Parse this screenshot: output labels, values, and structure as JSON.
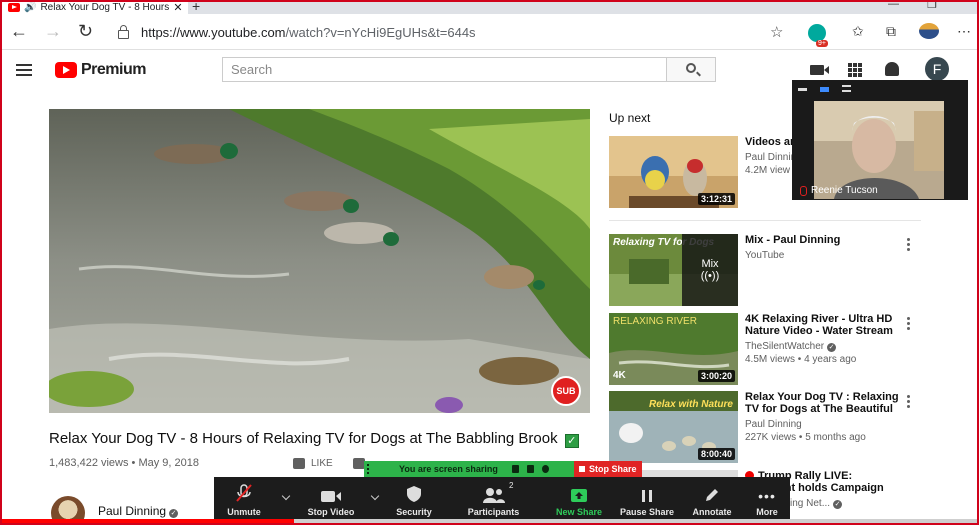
{
  "browser": {
    "tab_title": "Relax Your Dog TV - 8 Hours",
    "new_tab": "+",
    "window_minimize": "—",
    "window_restore": "❐",
    "url_host": "https://www.youtube.com",
    "url_rest": "/watch?v=nYcHi9EgUHs&t=644s",
    "ext_badge": "9+"
  },
  "header": {
    "logo_text": "Premium",
    "search_placeholder": "Search",
    "avatar_letter": "F"
  },
  "video": {
    "title": "Relax Your Dog TV - 8 Hours of Relaxing TV for Dogs at The Babbling Brook",
    "title_badge": "✓",
    "views": "1,483,422 views • May 9, 2018",
    "like_label": "LIKE",
    "channel": "Paul Dinning",
    "sub_watermark": "SUB",
    "progress": 0.3
  },
  "upnext": {
    "label": "Up next",
    "items": [
      {
        "title": "Videos an Garden Bi",
        "channel": "Paul Dinnin",
        "meta": "4.2M view",
        "duration": "3:12:31"
      },
      {
        "title": "Mix - Paul Dinning",
        "channel": "YouTube",
        "meta": "",
        "duration": "",
        "overlay": "Relaxing TV for Dogs",
        "mix_label": "Mix"
      },
      {
        "title": "4K Relaxing River - Ultra HD Nature Video - Water Stream &...",
        "channel": "TheSilentWatcher",
        "meta": "4.5M views • 4 years ago",
        "duration": "3:00:20",
        "overlay": "RELAXING RIVER",
        "corner": "4K"
      },
      {
        "title": "Relax Your Dog TV : Relaxing TV for Dogs at The Beautiful Sprin...",
        "channel": "Paul Dinning",
        "meta": "227K views • 5 months ago",
        "duration": "8:00:40",
        "overlay": "Relax with Nature"
      },
      {
        "title": "Trump Rally LIVE: President holds Campaign Event ...",
        "channel": "Broadcasting Net...",
        "meta": "",
        "duration": ""
      }
    ]
  },
  "zoom": {
    "participant_name": "Reenie Tucson",
    "sharing_text": "You are screen sharing",
    "stop_share": "Stop Share",
    "participants_count": "2",
    "toolbar": [
      {
        "label": "Unmute",
        "icon": "mic-muted-icon"
      },
      {
        "label": "Stop Video",
        "icon": "video-camera-icon"
      },
      {
        "label": "Security",
        "icon": "shield-icon"
      },
      {
        "label": "Participants",
        "icon": "participants-icon"
      },
      {
        "label": "New Share",
        "icon": "share-screen-icon"
      },
      {
        "label": "Pause Share",
        "icon": "pause-icon"
      },
      {
        "label": "Annotate",
        "icon": "pencil-icon"
      },
      {
        "label": "More",
        "icon": "more-dots-icon"
      }
    ]
  },
  "colors": {
    "brand_red": "#ff0000",
    "zoom_green": "#2db34a",
    "stop_red": "#e02424"
  }
}
